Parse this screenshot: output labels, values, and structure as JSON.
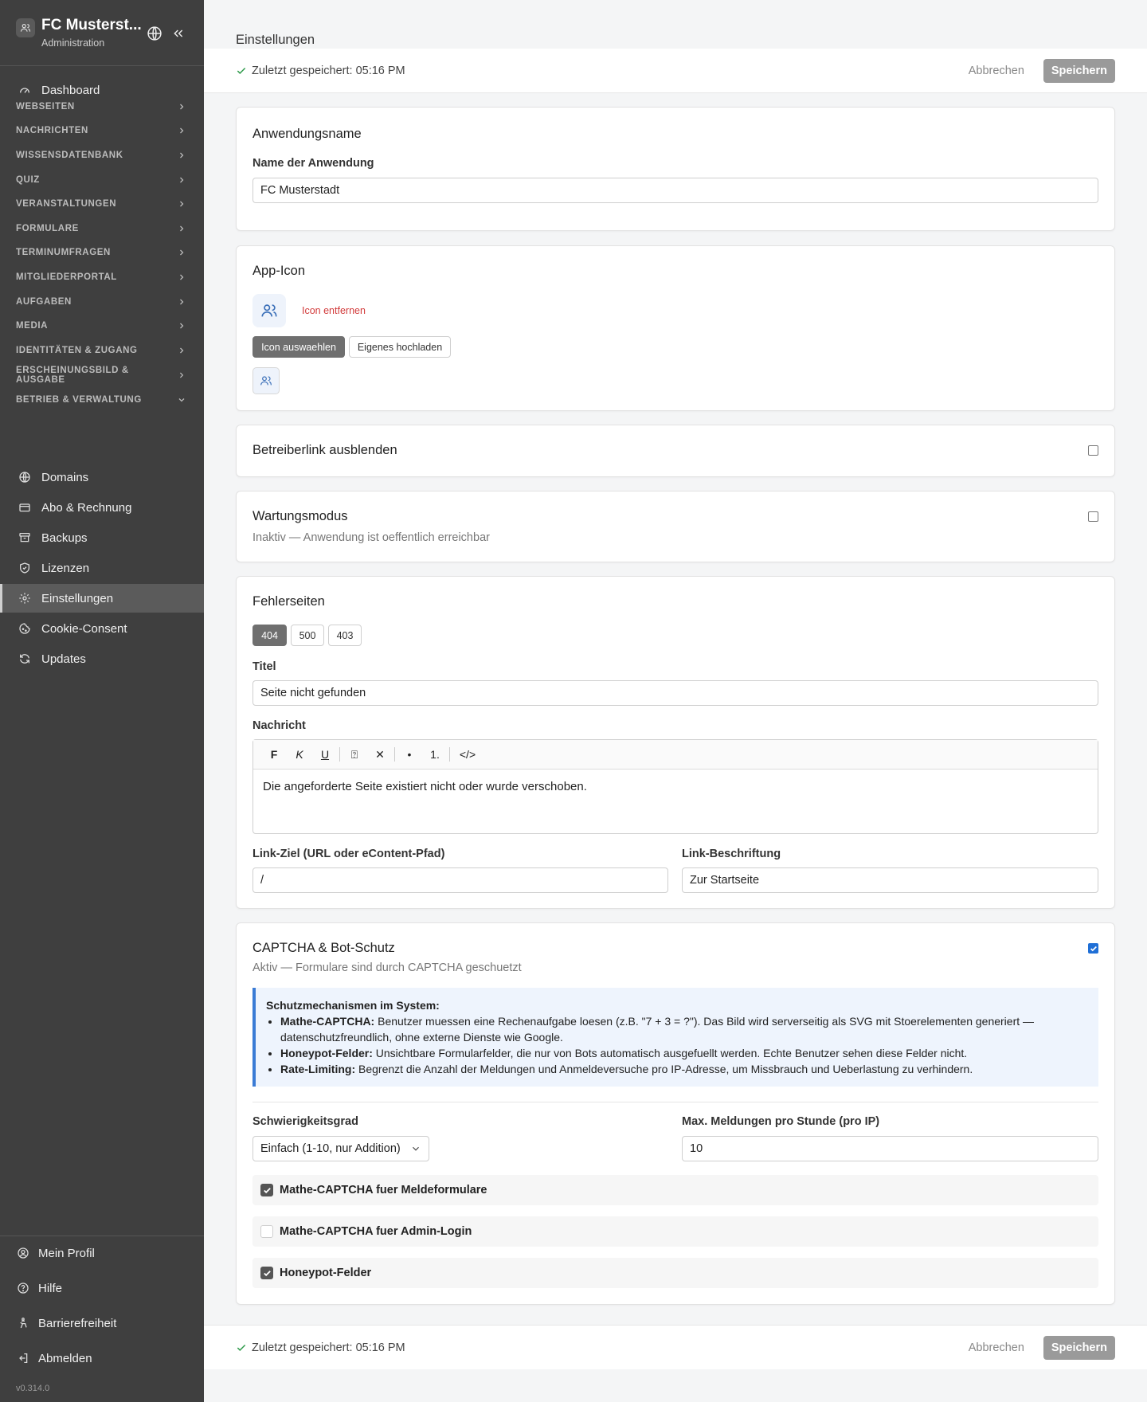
{
  "app": {
    "title": "FC Musterst...",
    "subtitle": "Administration",
    "version": "v0.314.0"
  },
  "sidebar": {
    "dashboard": "Dashboard",
    "sections": [
      {
        "label": "WEBSEITEN"
      },
      {
        "label": "NACHRICHTEN"
      },
      {
        "label": "WISSENSDATENBANK"
      },
      {
        "label": "QUIZ"
      },
      {
        "label": "VERANSTALTUNGEN"
      },
      {
        "label": "FORMULARE"
      },
      {
        "label": "TERMINUMFRAGEN"
      },
      {
        "label": "MITGLIEDERPORTAL"
      },
      {
        "label": "AUFGABEN"
      },
      {
        "label": "MEDIA"
      },
      {
        "label": "IDENTITÄTEN & ZUGANG"
      },
      {
        "label": "ERSCHEINUNGSBILD & AUSGABE"
      },
      {
        "label": "BETRIEB & VERWALTUNG"
      }
    ],
    "sub_items": [
      {
        "label": "Domains",
        "icon": "globe-icon"
      },
      {
        "label": "Abo & Rechnung",
        "icon": "card-icon"
      },
      {
        "label": "Backups",
        "icon": "archive-icon"
      },
      {
        "label": "Lizenzen",
        "icon": "shield-icon"
      },
      {
        "label": "Einstellungen",
        "icon": "gear-icon"
      },
      {
        "label": "Cookie-Consent",
        "icon": "cookie-icon"
      },
      {
        "label": "Updates",
        "icon": "refresh-icon"
      }
    ],
    "footer": [
      {
        "label": "Mein Profil",
        "icon": "user-icon"
      },
      {
        "label": "Hilfe",
        "icon": "help-icon"
      },
      {
        "label": "Barrierefreiheit",
        "icon": "accessibility-icon"
      },
      {
        "label": "Abmelden",
        "icon": "logout-icon"
      }
    ]
  },
  "page": {
    "title": "Einstellungen",
    "saved_text": "Zuletzt gespeichert: 05:16 PM",
    "cancel_label": "Abbrechen",
    "save_label": "Speichern"
  },
  "appname": {
    "title": "Anwendungsname",
    "label": "Name der Anwendung",
    "value": "FC Musterstadt"
  },
  "appicon": {
    "title": "App-Icon",
    "remove_label": "Icon entfernen",
    "choose_label": "Icon auswaehlen",
    "upload_label": "Eigenes hochladen"
  },
  "operatorlink": {
    "title": "Betreiberlink ausblenden",
    "checked": false
  },
  "maintenance": {
    "title": "Wartungsmodus",
    "status": "Inaktiv — Anwendung ist oeffentlich erreichbar",
    "checked": false
  },
  "errorpages": {
    "title": "Fehlerseiten",
    "tabs": [
      "404",
      "500",
      "403"
    ],
    "active_tab": "404",
    "title_label": "Titel",
    "title_value": "Seite nicht gefunden",
    "message_label": "Nachricht",
    "toolbar": [
      "F",
      "K",
      "U",
      "⍰",
      "✕",
      "•",
      "1.",
      "</>"
    ],
    "message_value": "Die angeforderte Seite existiert nicht oder wurde verschoben.",
    "link_target_label": "Link-Ziel (URL oder eContent-Pfad)",
    "link_target_value": "/",
    "link_caption_label": "Link-Beschriftung",
    "link_caption_value": "Zur Startseite"
  },
  "captcha": {
    "title": "CAPTCHA & Bot-Schutz",
    "status": "Aktiv — Formulare sind durch CAPTCHA geschuetzt",
    "checked": true,
    "info_title": "Schutzmechanismen im System:",
    "info_items": [
      {
        "term": "Mathe-CAPTCHA:",
        "text": " Benutzer muessen eine Rechenaufgabe loesen (z.B. \"7 + 3 = ?\"). Das Bild wird serverseitig als SVG mit Stoerelementen generiert — datenschutzfreundlich, ohne externe Dienste wie Google."
      },
      {
        "term": "Honeypot-Felder:",
        "text": " Unsichtbare Formularfelder, die nur von Bots automatisch ausgefuellt werden. Echte Benutzer sehen diese Felder nicht."
      },
      {
        "term": "Rate-Limiting:",
        "text": " Begrenzt die Anzahl der Meldungen und Anmeldeversuche pro IP-Adresse, um Missbrauch und Ueberlastung zu verhindern."
      }
    ],
    "difficulty_label": "Schwierigkeitsgrad",
    "difficulty_value": "Einfach (1-10, nur Addition)",
    "max_label": "Max. Meldungen pro Stunde (pro IP)",
    "max_value": "10",
    "options": [
      {
        "label": "Mathe-CAPTCHA fuer Meldeformulare",
        "checked": true
      },
      {
        "label": "Mathe-CAPTCHA fuer Admin-Login",
        "checked": false
      },
      {
        "label": "Honeypot-Felder",
        "checked": true
      }
    ]
  },
  "colors": {
    "sidebar_bg": "#3f3f3f",
    "accent": "#1f6fd6",
    "danger": "#d23b3b"
  }
}
